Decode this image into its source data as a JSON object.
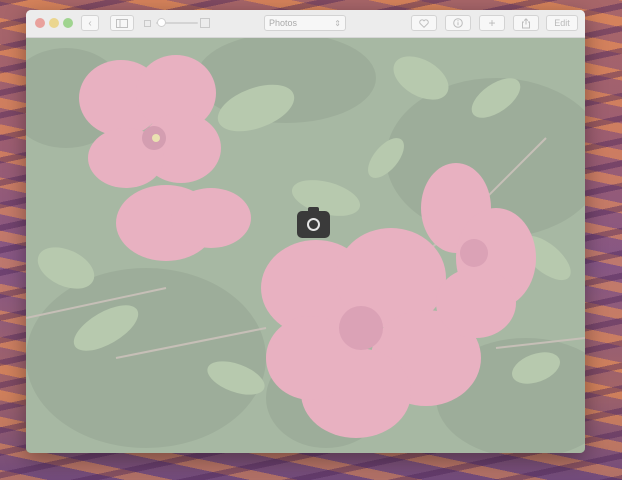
{
  "window": {
    "controls": [
      "close-button",
      "minimize-button",
      "zoom-button"
    ]
  },
  "toolbar": {
    "back_icon": "‹",
    "sidebar_icon": "sidebar-toggle",
    "album_select": {
      "selected": "Photos",
      "chevron": "⌃⌄"
    },
    "favorite_icon": "heart",
    "info_icon": "info",
    "add_icon": "+",
    "share_icon": "share",
    "edit_label": "Edit"
  },
  "photo": {
    "subject": "pink mandevilla flowers",
    "overlay_icon": "camera-icon"
  },
  "colors": {
    "toolbar_bg": "#ececec",
    "veil": "rgba(235,235,235,0.55)",
    "camera_badge": "#3a3a3a"
  }
}
